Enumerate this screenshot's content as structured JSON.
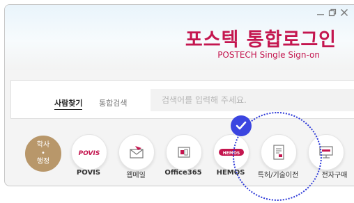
{
  "window": {
    "controls": [
      "minimize-icon",
      "restore-icon",
      "close-icon"
    ]
  },
  "header": {
    "title": "포스텍 통합로그인",
    "subtitle": "POSTECH Single Sign-on",
    "title_color": "#c4164f"
  },
  "search": {
    "tabs": [
      {
        "label": "사람찾기",
        "active": true
      },
      {
        "label": "통합검색",
        "active": false
      }
    ],
    "placeholder": "검색어를 입력해 주세요."
  },
  "apps": [
    {
      "label": "학사\n•\n행정",
      "icon": "academic-admin-icon",
      "accent": "#b8976a"
    },
    {
      "label": "POVIS",
      "icon": "povis-logo-icon",
      "accent": "#c4164f"
    },
    {
      "label": "웹메일",
      "icon": "mail-icon",
      "accent": "#c4164f"
    },
    {
      "label": "Office365",
      "icon": "office365-icon",
      "accent": "#c4164f"
    },
    {
      "label": "HEMOS",
      "icon": "hemos-logo-icon",
      "accent": "#c4164f"
    },
    {
      "label": "특허/기술이전",
      "icon": "patent-document-icon",
      "accent": "#c4164f"
    },
    {
      "label": "전자구매",
      "icon": "e-procurement-icon",
      "accent": "#c4164f"
    }
  ],
  "highlight": {
    "target": "특허/기술이전",
    "check_color": "#3b45e0"
  },
  "brand_logos": {
    "povis_logo_text": "POVIS",
    "hemos_logo_text": "HEMOS"
  }
}
